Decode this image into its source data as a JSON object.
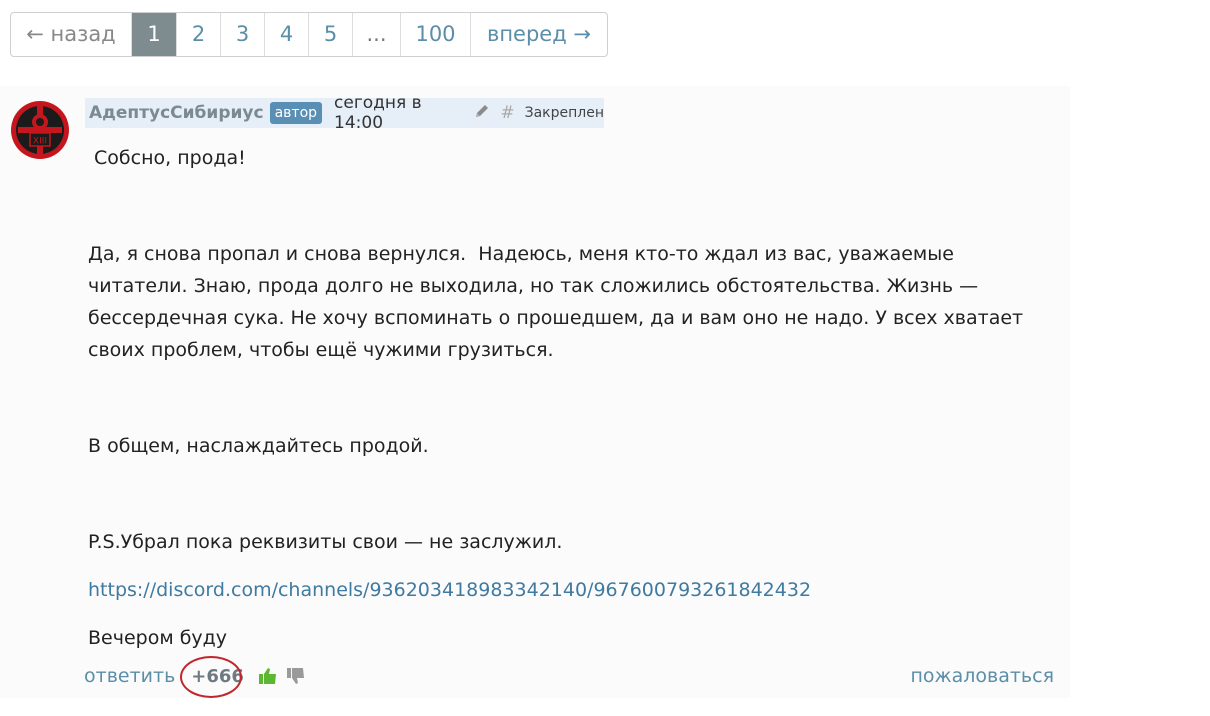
{
  "pagination": {
    "prev": "← назад",
    "pages": [
      "1",
      "2",
      "3",
      "4",
      "5"
    ],
    "dots": "...",
    "last": "100",
    "next": "вперед →"
  },
  "post": {
    "author": "АдептусСибириус",
    "badge": "автор",
    "date": "сегодня в 14:00",
    "hash": "#",
    "pinned": "Закреплен",
    "paragraphs": [
      " Собсно, прода!",
      "Да, я снова пропал и снова вернулся.  Надеюсь, меня кто-то ждал из вас, уважаемые читатели. Знаю, прода долго не выходила, но так сложились обстоятельства. Жизнь — бессердечная сука. Не хочу вспоминать о прошедшем, да и вам оно не надо. У всех хватает своих проблем, чтобы ещё чужими грузиться.",
      "В общем, наслаждайтесь продой.",
      "P.S.Убрал пока реквизиты свои — не заслужил."
    ],
    "link": "https://discord.com/channels/936203418983342140/967600793261842432",
    "closing": "Вечером буду",
    "reply": "ответить",
    "score": "+666",
    "report": "пожаловаться",
    "avatar_text": "XIII"
  }
}
